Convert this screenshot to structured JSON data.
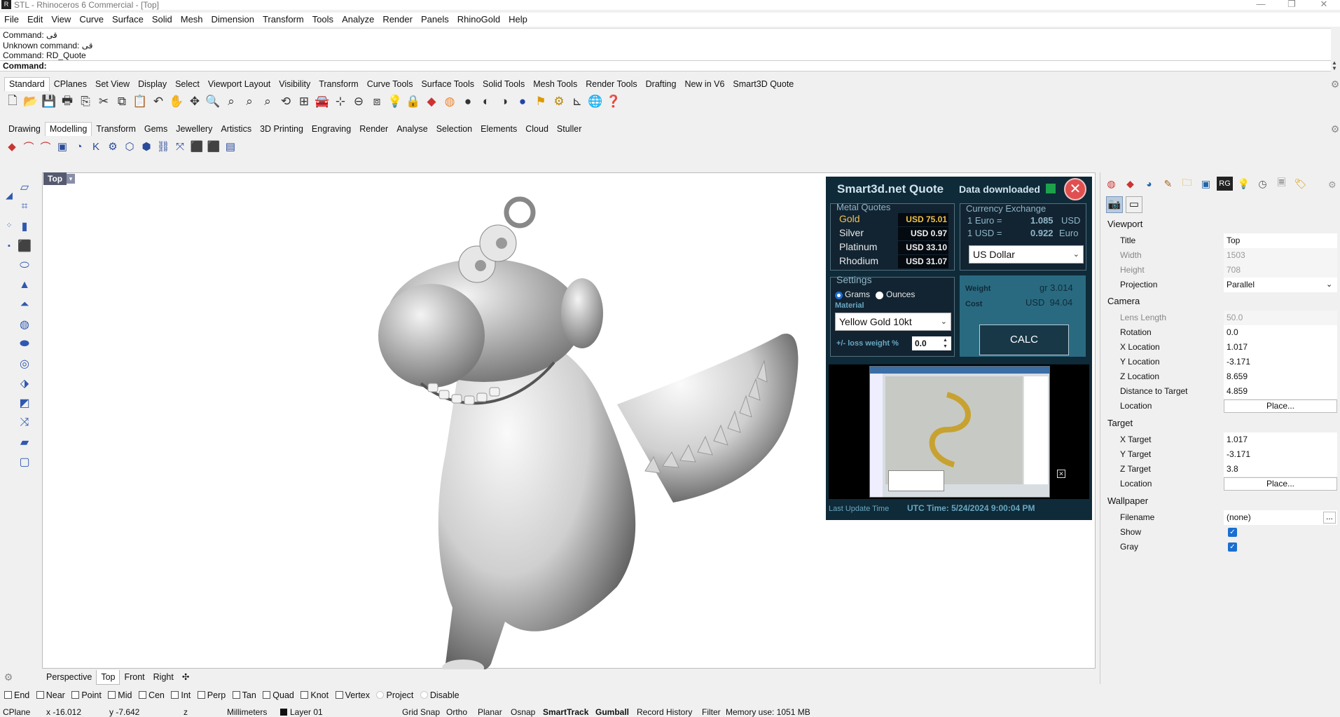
{
  "window": {
    "title": "STL - Rhinoceros 6 Commercial - [Top]",
    "app_icon": "rhino-icon",
    "controls": [
      "—",
      "❐",
      "✕"
    ]
  },
  "menu": [
    "File",
    "Edit",
    "View",
    "Curve",
    "Surface",
    "Solid",
    "Mesh",
    "Dimension",
    "Transform",
    "Tools",
    "Analyze",
    "Render",
    "Panels",
    "RhinoGold",
    "Help"
  ],
  "command_history": [
    "Command: قی",
    "Unknown command: قی",
    "Command: RD_Quote"
  ],
  "command_prompt": "Command:",
  "toolbar_tabs": [
    "Standard",
    "CPlanes",
    "Set View",
    "Display",
    "Select",
    "Viewport Layout",
    "Visibility",
    "Transform",
    "Curve Tools",
    "Surface Tools",
    "Solid Tools",
    "Mesh Tools",
    "Render Tools",
    "Drafting",
    "New in V6",
    "Smart3D Quote"
  ],
  "rhinogold_tabs": [
    "Drawing",
    "Modelling",
    "Transform",
    "Gems",
    "Jewellery",
    "Artistics",
    "3D Printing",
    "Engraving",
    "Render",
    "Analyse",
    "Selection",
    "Elements",
    "Cloud",
    "Stuller"
  ],
  "viewport": {
    "label": "Top",
    "label_arrow": "▾",
    "tabs": [
      "Perspective",
      "Top",
      "Front",
      "Right",
      "✣"
    ],
    "active_tab": "Top"
  },
  "quote": {
    "title": "Smart3d.net Quote",
    "status": "Data downloaded",
    "close": "✕",
    "metal_header": "Metal Quotes",
    "metals": [
      {
        "name": "Gold",
        "value": "USD 75.01"
      },
      {
        "name": "Silver",
        "value": "USD 0.97"
      },
      {
        "name": "Platinum",
        "value": "USD 33.10"
      },
      {
        "name": "Rhodium",
        "value": "USD 31.07"
      }
    ],
    "currency_header": "Currency Exchange",
    "rates": [
      {
        "label": "1 Euro =",
        "value": "1.085",
        "unit": "USD"
      },
      {
        "label": "1 USD =",
        "value": "0.922",
        "unit": "Euro"
      }
    ],
    "currency_selected": "US Dollar",
    "settings_header": "Settings",
    "unit_grams": "Grams",
    "unit_ounces": "Ounces",
    "material_label": "Material",
    "material_selected": "Yellow Gold 10kt",
    "loss_label": "+/- loss weight %",
    "loss_value": "0.0",
    "weight_label": "Weight",
    "weight_value": "gr 3.014",
    "cost_label": "Cost",
    "cost_value": "USD  94.04",
    "calc_label": "CALC",
    "last_update_label": "Last Update Time",
    "utc_time": "UTC Time: 5/24/2024 9:00:04 PM",
    "preview_close": "✕"
  },
  "properties": {
    "icons": [
      "color-wheel-icon",
      "material-icon",
      "render-icon",
      "brush-icon",
      "folder-icon",
      "window-icon",
      "rg-icon",
      "bulb-icon",
      "clock-icon",
      "doc-icon",
      "tag-icon"
    ],
    "sections": {
      "viewport": "Viewport",
      "camera": "Camera",
      "target": "Target",
      "wallpaper": "Wallpaper"
    },
    "viewport_rows": [
      {
        "label": "Title",
        "value": "Top"
      },
      {
        "label": "Width",
        "value": "1503"
      },
      {
        "label": "Height",
        "value": "708"
      },
      {
        "label": "Projection",
        "value": "Parallel"
      }
    ],
    "camera_rows": [
      {
        "label": "Lens Length",
        "value": "50.0"
      },
      {
        "label": "Rotation",
        "value": "0.0"
      },
      {
        "label": "X Location",
        "value": "1.017"
      },
      {
        "label": "Y Location",
        "value": "-3.171"
      },
      {
        "label": "Z Location",
        "value": "8.659"
      },
      {
        "label": "Distance to Target",
        "value": "4.859"
      },
      {
        "label": "Location",
        "value": "Place..."
      }
    ],
    "target_rows": [
      {
        "label": "X Target",
        "value": "1.017"
      },
      {
        "label": "Y Target",
        "value": "-3.171"
      },
      {
        "label": "Z Target",
        "value": "3.8"
      },
      {
        "label": "Location",
        "value": "Place..."
      }
    ],
    "wallpaper_rows": [
      {
        "label": "Filename",
        "value": "(none)"
      },
      {
        "label": "Show",
        "value": "✓"
      },
      {
        "label": "Gray",
        "value": "✓"
      }
    ],
    "more_button": "..."
  },
  "osnap": [
    "End",
    "Near",
    "Point",
    "Mid",
    "Cen",
    "Int",
    "Perp",
    "Tan",
    "Quad",
    "Knot",
    "Vertex",
    "Project",
    "Disable"
  ],
  "status": {
    "cplane": "CPlane",
    "x": "x -16.012",
    "y": "y -7.642",
    "z": "z",
    "units": "Millimeters",
    "layer": "Layer 01",
    "toggles": [
      "Grid Snap",
      "Ortho",
      "Planar",
      "Osnap",
      "SmartTrack",
      "Gumball",
      "Record History",
      "Filter"
    ],
    "memory": "Memory use: 1051 MB"
  }
}
